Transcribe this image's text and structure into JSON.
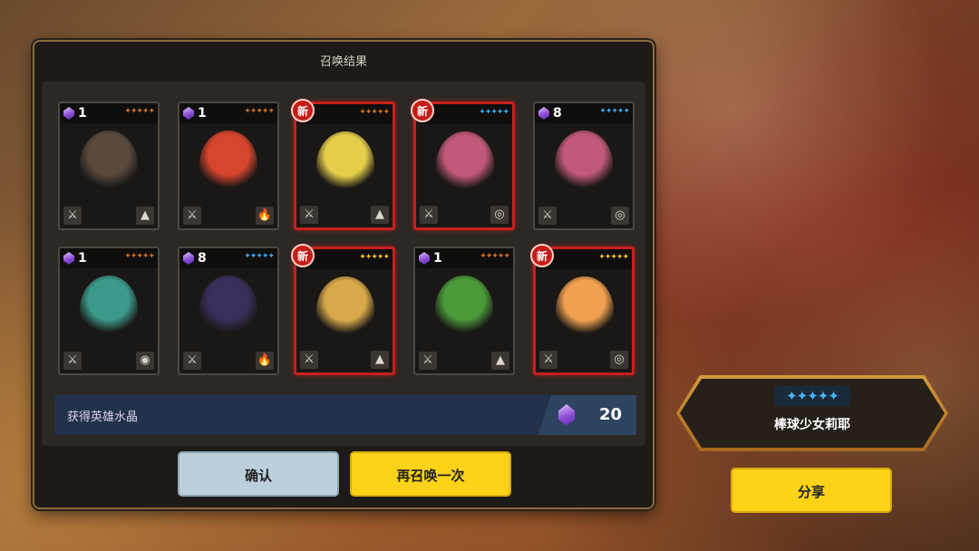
{
  "dialog": {
    "title": "召唤结果",
    "footer_label": "获得英雄水晶",
    "crystal_total": "20"
  },
  "buttons": {
    "confirm": "确认",
    "summon_again": "再召唤一次",
    "share": "分享"
  },
  "featured_hero": {
    "name": "棒球少女莉耶",
    "stars": "✦✦✦✦✦"
  },
  "cards": [
    {
      "badge": "1",
      "is_new": false,
      "stars": "✦✦✦✦✦",
      "star_color": "orange",
      "role_icon": "⚔",
      "element_icon": "▲",
      "sprite_color": "#5a4a3e"
    },
    {
      "badge": "1",
      "is_new": false,
      "stars": "✦✦✦✦✦",
      "star_color": "orange",
      "role_icon": "⚔",
      "element_icon": "🔥",
      "sprite_color": "#d8452e"
    },
    {
      "badge": "新",
      "is_new": true,
      "stars": "✦✦✦✦✦",
      "star_color": "orange",
      "role_icon": "⚔",
      "element_icon": "▲",
      "sprite_color": "#e5cf4a"
    },
    {
      "badge": "新",
      "is_new": true,
      "stars": "✦✦✦✦✦",
      "star_color": "blue",
      "role_icon": "⚔",
      "element_icon": "◎",
      "sprite_color": "#c2597a"
    },
    {
      "badge": "8",
      "is_new": false,
      "stars": "✦✦✦✦✦",
      "star_color": "blue",
      "role_icon": "⚔",
      "element_icon": "◎",
      "sprite_color": "#c2597a"
    },
    {
      "badge": "1",
      "is_new": false,
      "stars": "✦✦✦✦✦",
      "star_color": "orange",
      "role_icon": "⚔",
      "element_icon": "◉",
      "sprite_color": "#3c9a8a"
    },
    {
      "badge": "8",
      "is_new": false,
      "stars": "✦✦✦✦✦",
      "star_color": "blue",
      "role_icon": "⚔",
      "element_icon": "🔥",
      "sprite_color": "#3a2e5a"
    },
    {
      "badge": "新",
      "is_new": true,
      "stars": "✦✦✦✦✦",
      "star_color": "gold",
      "role_icon": "⚔",
      "element_icon": "▲",
      "sprite_color": "#d8a84a"
    },
    {
      "badge": "1",
      "is_new": false,
      "stars": "✦✦✦✦✦",
      "star_color": "orange",
      "role_icon": "⚔",
      "element_icon": "▲",
      "sprite_color": "#4a9a3a"
    },
    {
      "badge": "新",
      "is_new": true,
      "stars": "✦✦✦✦✦",
      "star_color": "gold",
      "role_icon": "⚔",
      "element_icon": "◎",
      "sprite_color": "#f0a050"
    }
  ]
}
